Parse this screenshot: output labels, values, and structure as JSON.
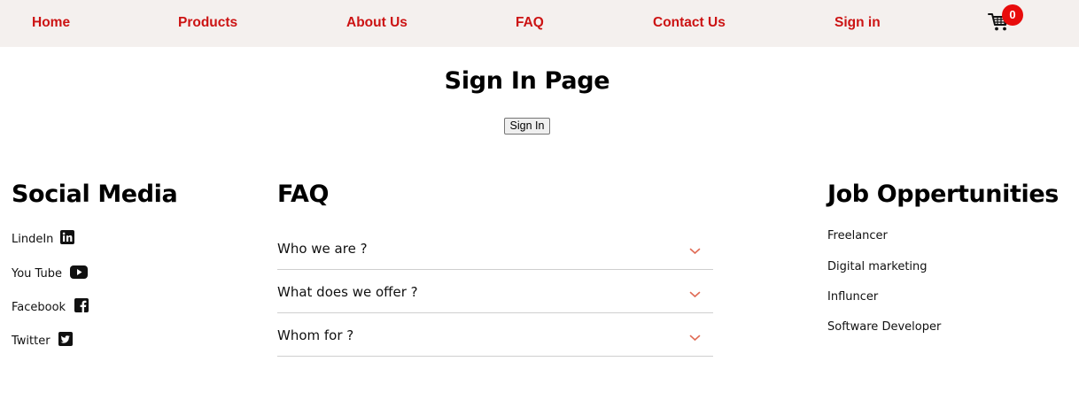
{
  "nav": {
    "links": [
      {
        "label": "Home"
      },
      {
        "label": "Products"
      },
      {
        "label": "About Us"
      },
      {
        "label": "FAQ"
      },
      {
        "label": "Contact Us"
      },
      {
        "label": "Sign in"
      }
    ],
    "cart_count": "0",
    "cart_icon": "shopping-cart-icon"
  },
  "main": {
    "title": "Sign In Page",
    "sign_in_button": "Sign In"
  },
  "social": {
    "heading": "Social Media",
    "items": [
      {
        "label": "LindeIn",
        "icon": "linkedin-icon"
      },
      {
        "label": "You Tube",
        "icon": "youtube-icon"
      },
      {
        "label": "Facebook",
        "icon": "facebook-icon"
      },
      {
        "label": "Twitter",
        "icon": "twitter-icon"
      }
    ]
  },
  "faq": {
    "heading": "FAQ",
    "items": [
      {
        "question": "Who we are ?"
      },
      {
        "question": "What does we offer ?"
      },
      {
        "question": "Whom for ?"
      }
    ]
  },
  "jobs": {
    "heading": "Job Oppertunities",
    "items": [
      {
        "label": "Freelancer"
      },
      {
        "label": "Digital marketing"
      },
      {
        "label": "Influncer"
      },
      {
        "label": "Software Developer"
      }
    ]
  },
  "colors": {
    "nav_bg": "#f4f0ee",
    "accent": "#cc1313",
    "badge": "#e80c0c",
    "chevron": "#e06b55"
  }
}
